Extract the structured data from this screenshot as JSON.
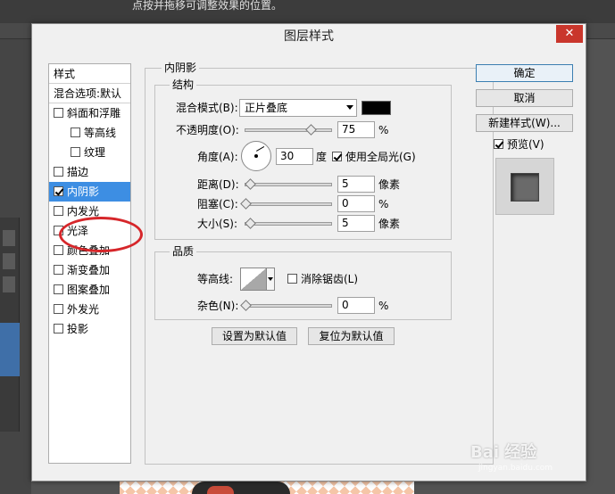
{
  "background": {
    "hint_text": "点按并拖移可调整效果的位置。"
  },
  "dialog": {
    "title": "图层样式",
    "close_glyph": "✕"
  },
  "style_list": {
    "header": "样式",
    "blend_options": "混合选项:默认",
    "items": [
      {
        "label": "斜面和浮雕",
        "checked": false
      },
      {
        "label": "等高线",
        "checked": false,
        "sub": true
      },
      {
        "label": "纹理",
        "checked": false,
        "sub": true
      },
      {
        "label": "描边",
        "checked": false
      },
      {
        "label": "内阴影",
        "checked": true,
        "selected": true
      },
      {
        "label": "内发光",
        "checked": false
      },
      {
        "label": "光泽",
        "checked": false
      },
      {
        "label": "颜色叠加",
        "checked": false
      },
      {
        "label": "渐变叠加",
        "checked": false
      },
      {
        "label": "图案叠加",
        "checked": false
      },
      {
        "label": "外发光",
        "checked": false
      },
      {
        "label": "投影",
        "checked": false
      }
    ]
  },
  "inner_shadow": {
    "title": "内阴影",
    "structure": {
      "title": "结构",
      "blend_mode_label": "混合模式(B):",
      "blend_mode_value": "正片叠底",
      "shadow_color": "#000000",
      "opacity_label": "不透明度(O):",
      "opacity_value": "75",
      "opacity_level": 75,
      "percent": "%",
      "angle_label": "角度(A):",
      "angle_value": "30",
      "angle_unit": "度",
      "global_light_label": "使用全局光(G)",
      "global_light_checked": true,
      "distance_label": "距离(D):",
      "distance_value": "5",
      "distance_unit": "像素",
      "choke_label": "阻塞(C):",
      "choke_value": "0",
      "choke_unit": "%",
      "size_label": "大小(S):",
      "size_value": "5",
      "size_unit": "像素"
    },
    "quality": {
      "title": "品质",
      "contour_label": "等高线:",
      "anti_alias_label": "消除锯齿(L)",
      "anti_alias_checked": false,
      "noise_label": "杂色(N):",
      "noise_value": "0",
      "percent": "%"
    },
    "make_default": "设置为默认值",
    "reset_default": "复位为默认值"
  },
  "actions": {
    "ok": "确定",
    "cancel": "取消",
    "new_style": "新建样式(W)...",
    "preview_label": "预览(V)",
    "preview_checked": true
  },
  "watermark": {
    "brand": "Bai 经验",
    "url": "jingyan.baidu.com"
  },
  "colors": {
    "selection": "#3d8ee3",
    "close": "#c9362c",
    "highlight_ring": "#d6262a"
  }
}
